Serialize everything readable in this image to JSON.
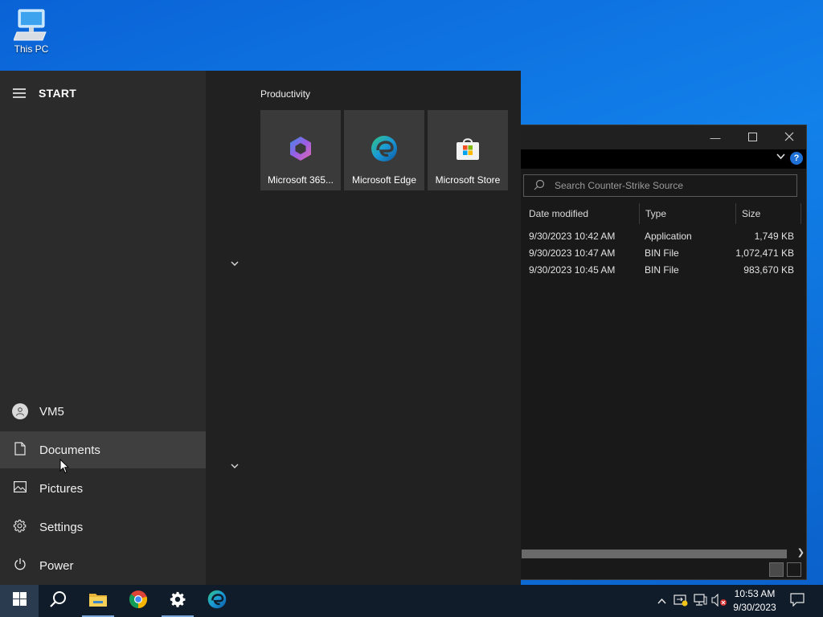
{
  "desktop": {
    "icons": [
      {
        "label": "This PC",
        "icon": "computer-icon"
      }
    ]
  },
  "explorer": {
    "search_placeholder": "Search Counter-Strike Source",
    "columns": [
      "Date modified",
      "Type",
      "Size"
    ],
    "rows": [
      {
        "date": "9/30/2023 10:42 AM",
        "type": "Application",
        "size": "1,749 KB"
      },
      {
        "date": "9/30/2023 10:47 AM",
        "type": "BIN File",
        "size": "1,072,471 KB"
      },
      {
        "date": "9/30/2023 10:45 AM",
        "type": "BIN File",
        "size": "983,670 KB"
      }
    ],
    "window_buttons": [
      "minimize-icon",
      "maximize-icon",
      "close-icon"
    ],
    "help_label": "?"
  },
  "start_menu": {
    "title": "START",
    "user": "VM5",
    "items": [
      {
        "label": "Documents",
        "icon": "document-icon"
      },
      {
        "label": "Pictures",
        "icon": "pictures-icon"
      },
      {
        "label": "Settings",
        "icon": "gear-icon"
      },
      {
        "label": "Power",
        "icon": "power-icon"
      }
    ],
    "group_label": "Productivity",
    "tiles": [
      {
        "label": "Microsoft 365...",
        "icon": "microsoft-365-icon"
      },
      {
        "label": "Microsoft Edge",
        "icon": "edge-icon"
      },
      {
        "label": "Microsoft Store",
        "icon": "store-icon"
      }
    ]
  },
  "taskbar": {
    "apps": [
      "windows-start-icon",
      "search-icon",
      "file-explorer-icon",
      "chrome-icon",
      "settings-icon",
      "edge-icon"
    ],
    "tray_icons": [
      "chevron-up-icon",
      "network-warning-icon",
      "network-icon",
      "volume-muted-icon"
    ],
    "time": "10:53 AM",
    "date": "9/30/2023"
  },
  "colors": {
    "desktop_blue": "#0a63d6",
    "start_bg": "#212121",
    "start_left_bg": "#2b2b2b",
    "tile_bg": "#3a3a3a",
    "taskbar_bg": "#101c2a"
  }
}
